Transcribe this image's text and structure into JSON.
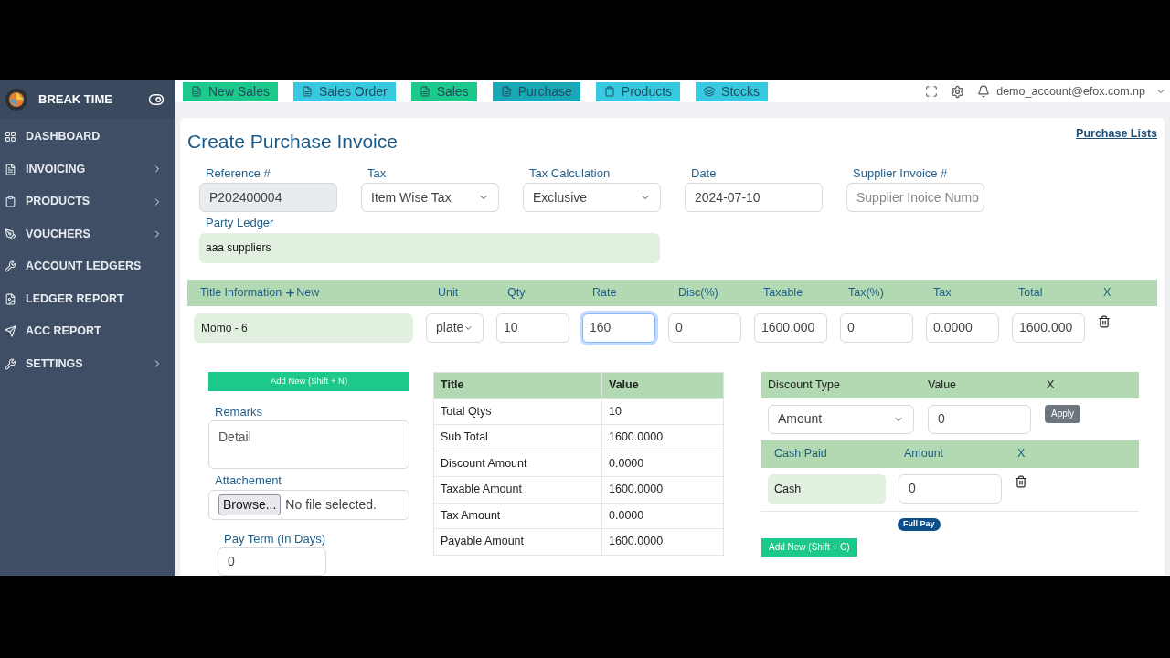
{
  "sidebar": {
    "brand": "BREAK TIME",
    "items": [
      {
        "label": "DASHBOARD",
        "submenu": false
      },
      {
        "label": "INVOICING",
        "submenu": true
      },
      {
        "label": "PRODUCTS",
        "submenu": true
      },
      {
        "label": "VOUCHERS",
        "submenu": true
      },
      {
        "label": "ACCOUNT LEDGERS",
        "submenu": false
      },
      {
        "label": "LEDGER REPORT",
        "submenu": false
      },
      {
        "label": "ACC REPORT",
        "submenu": false
      },
      {
        "label": "SETTINGS",
        "submenu": true
      }
    ]
  },
  "topbar": {
    "shortcuts": [
      {
        "label": "New Sales",
        "kind": "success",
        "selected": false
      },
      {
        "label": "Sales Order",
        "kind": "info",
        "selected": false
      },
      {
        "label": "Sales",
        "kind": "success",
        "selected": false
      },
      {
        "label": "Purchase",
        "kind": "info",
        "selected": true
      },
      {
        "label": "Products",
        "kind": "info",
        "selected": false
      },
      {
        "label": "Stocks",
        "kind": "info",
        "selected": false
      }
    ],
    "user": "demo_account@efox.com.np"
  },
  "page": {
    "title": "Create Purchase Invoice",
    "link": "Purchase Lists"
  },
  "form": {
    "fields": [
      {
        "label": "Reference #",
        "kind": "readonly",
        "value": "P202400004"
      },
      {
        "label": "Tax",
        "kind": "select",
        "value": "Item Wise Tax"
      },
      {
        "label": "Tax Calculation",
        "kind": "select",
        "value": "Exclusive"
      },
      {
        "label": "Date",
        "kind": "input",
        "value": "2024-07-10"
      },
      {
        "label": "Supplier Invoice #",
        "kind": "input",
        "placeholder": "Supplier Inoice Numb"
      }
    ],
    "party_ledger": {
      "label": "Party Ledger",
      "value": "aaa suppliers"
    }
  },
  "items": {
    "columns": [
      "Title Information",
      "Unit",
      "Qty",
      "Rate",
      "Disc(%)",
      "Taxable",
      "Tax(%)",
      "Tax",
      "Total",
      "X"
    ],
    "new_label": "New",
    "rows": [
      {
        "cells": [
          {
            "kind": "product",
            "value": "Momo - 6",
            "focused": false
          },
          {
            "kind": "select",
            "value": "plate",
            "focused": false
          },
          {
            "kind": "input",
            "value": "10",
            "focused": false
          },
          {
            "kind": "input",
            "value": "160",
            "focused": true
          },
          {
            "kind": "input",
            "value": "0",
            "focused": false
          },
          {
            "kind": "input",
            "value": "1600.000",
            "focused": false
          },
          {
            "kind": "input",
            "value": "0",
            "focused": false
          },
          {
            "kind": "input",
            "value": "0.0000",
            "focused": false
          },
          {
            "kind": "input",
            "value": "1600.000",
            "focused": false
          }
        ]
      }
    ]
  },
  "extras": {
    "add_button": "Add New (Shift + N)",
    "remarks": {
      "label": "Remarks",
      "placeholder": "Detail"
    },
    "attachment": {
      "label": "Attachement",
      "button": "Browse...",
      "status": "No file selected."
    },
    "pay_term": {
      "label": "Pay Term (In Days)",
      "value": "0"
    }
  },
  "summary": {
    "columns": [
      "Title",
      "Value"
    ],
    "rows": [
      [
        "Total Qtys",
        "10"
      ],
      [
        "Sub Total",
        "1600.0000"
      ],
      [
        "Discount Amount",
        "0.0000"
      ],
      [
        "Taxable Amount",
        "1600.0000"
      ],
      [
        "Tax Amount",
        "0.0000"
      ],
      [
        "Payable Amount",
        "1600.0000"
      ]
    ]
  },
  "discount": {
    "columns": [
      "Discount Type",
      "Value",
      "X"
    ],
    "type": "Amount",
    "value": "0",
    "apply": "Apply"
  },
  "payments": {
    "columns": [
      "Cash Paid",
      "Amount",
      "X"
    ],
    "rows": [
      {
        "method": "Cash",
        "amount": "0"
      }
    ],
    "full_pay": "Full Pay",
    "add_button": "Add New (Shift + C)"
  }
}
